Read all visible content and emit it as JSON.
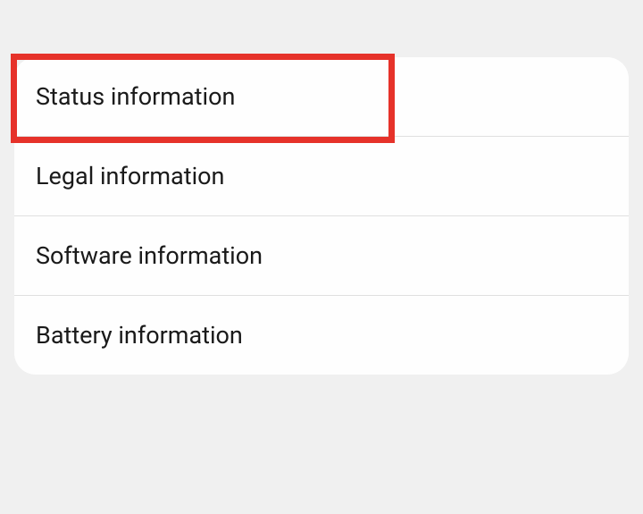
{
  "settings": {
    "items": [
      {
        "label": "Status information"
      },
      {
        "label": "Legal information"
      },
      {
        "label": "Software information"
      },
      {
        "label": "Battery information"
      }
    ]
  }
}
